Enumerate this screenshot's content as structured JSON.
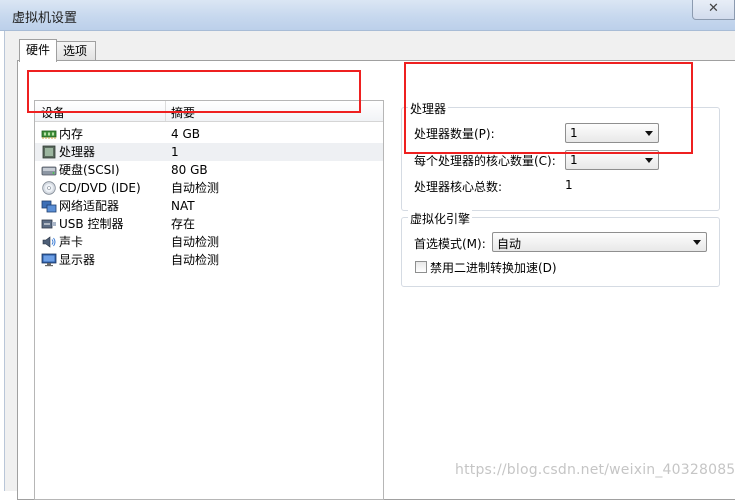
{
  "window": {
    "title": "虚拟机设置",
    "close_glyph": "✕"
  },
  "tabs": [
    {
      "label": "硬件"
    },
    {
      "label": "选项"
    }
  ],
  "device_list": {
    "col_device": "设备",
    "col_summary": "摘要",
    "rows": [
      {
        "name": "内存",
        "summary": "4 GB",
        "icon": "memory-icon"
      },
      {
        "name": "处理器",
        "summary": "1",
        "icon": "processor-icon"
      },
      {
        "name": "硬盘(SCSI)",
        "summary": "80 GB",
        "icon": "hard-disk-icon"
      },
      {
        "name": "CD/DVD (IDE)",
        "summary": "自动检测",
        "icon": "cd-dvd-icon"
      },
      {
        "name": "网络适配器",
        "summary": "NAT",
        "icon": "network-adapter-icon"
      },
      {
        "name": "USB 控制器",
        "summary": "存在",
        "icon": "usb-icon"
      },
      {
        "name": "声卡",
        "summary": "自动检测",
        "icon": "sound-card-icon"
      },
      {
        "name": "显示器",
        "summary": "自动检测",
        "icon": "display-icon"
      }
    ],
    "selected_index": 1
  },
  "processors": {
    "title": "处理器",
    "count_label": "处理器数量(P):",
    "count_value": "1",
    "cores_label": "每个处理器的核心数量(C):",
    "cores_value": "1",
    "total_label": "处理器核心总数:",
    "total_value": "1"
  },
  "virtualization": {
    "title": "虚拟化引擎",
    "mode_label": "首选模式(M):",
    "mode_value": "自动",
    "binary_accel_label": "禁用二进制转换加速(D)",
    "binary_accel_checked": false
  },
  "annotation_color": "#ee2020",
  "watermark": "https://blog.csdn.net/weixin_40328085"
}
